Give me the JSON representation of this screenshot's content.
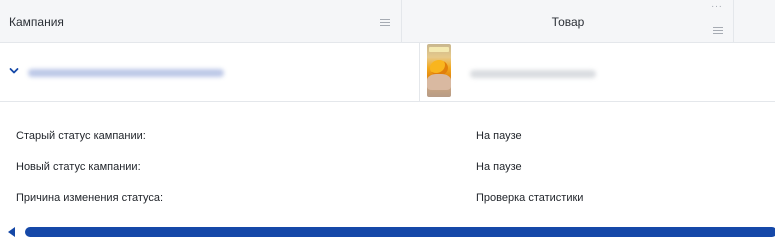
{
  "table": {
    "columns": [
      {
        "label": "Кампания"
      },
      {
        "label": "Товар"
      }
    ],
    "product_header_dots": "···"
  },
  "row": {
    "campaign_name": "",
    "product_name": "",
    "expanded": true
  },
  "details": [
    {
      "label": "Старый статус кампании:",
      "value": "На паузе"
    },
    {
      "label": "Новый статус кампании:",
      "value": "На паузе"
    },
    {
      "label": "Причина изменения статуса:",
      "value": "Проверка статистики"
    }
  ],
  "colors": {
    "accent": "#1548a8",
    "header_bg": "#f5f6f8",
    "border": "#e4e7eb"
  },
  "icons": {
    "column_menu": "menu-lines-icon",
    "expand": "chevron-down-icon",
    "scroll_left": "arrow-left-icon"
  }
}
